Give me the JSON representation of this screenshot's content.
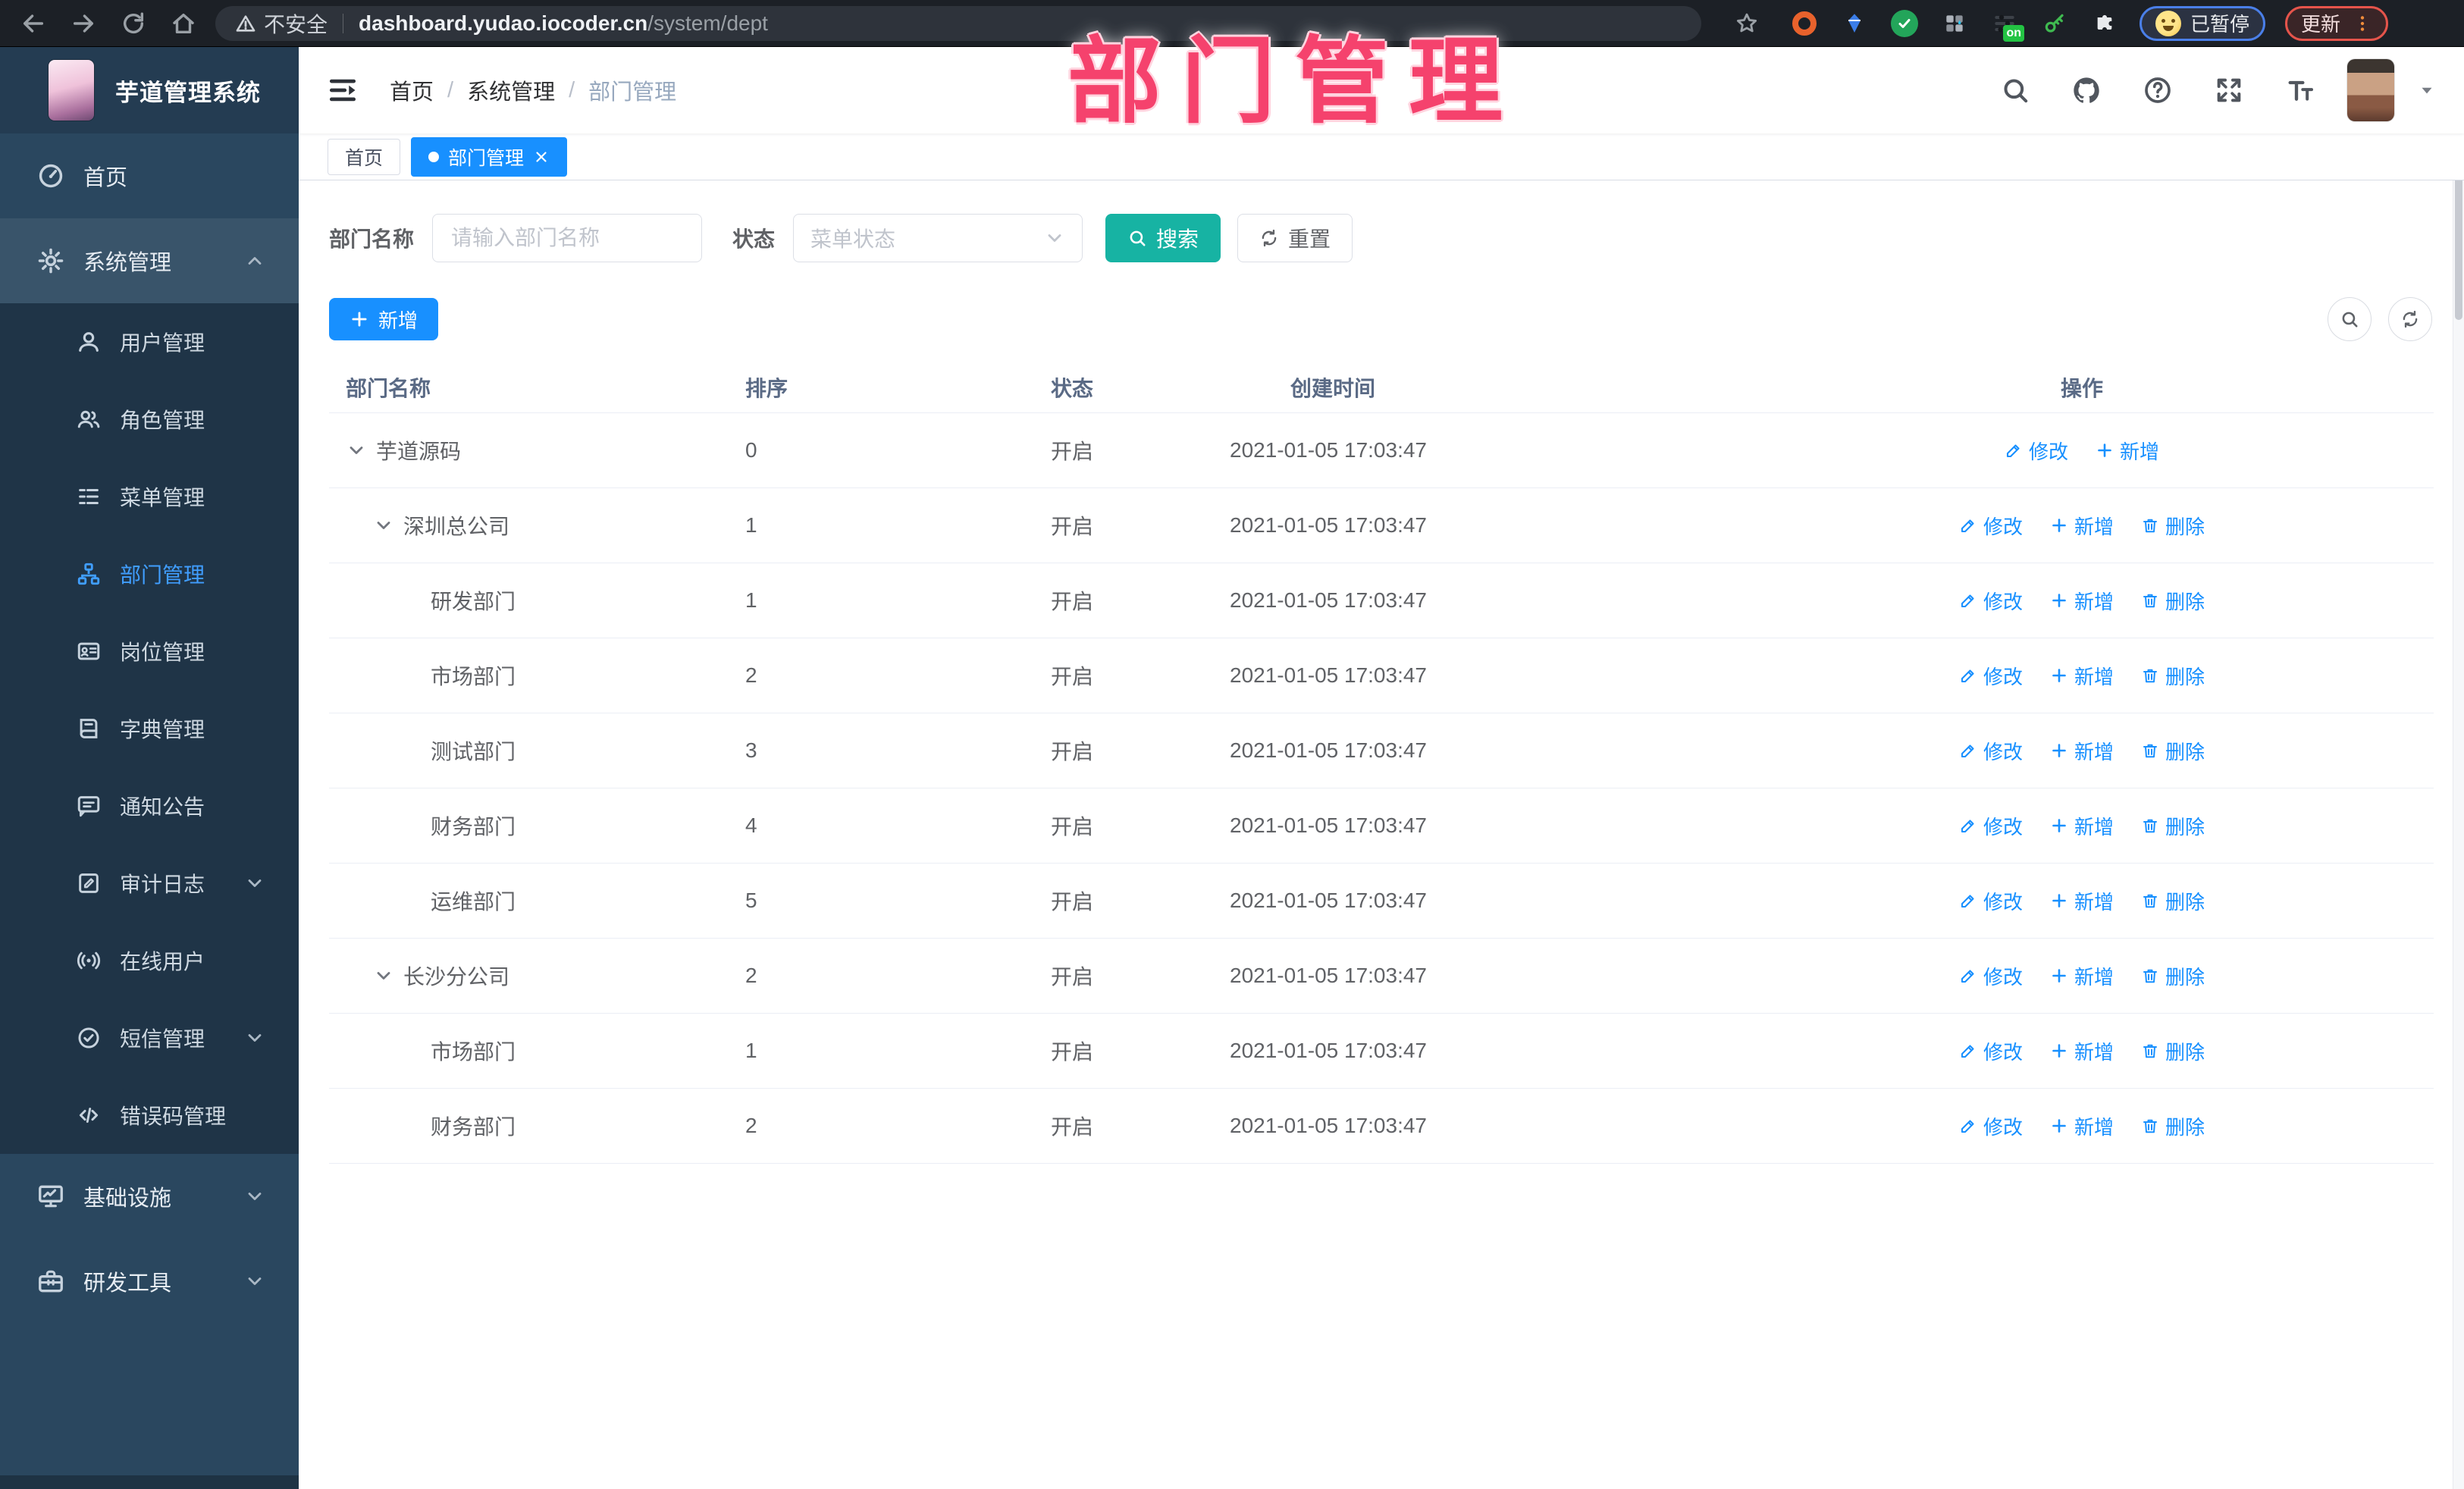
{
  "browser": {
    "security_label": "不安全",
    "url_domain": "dashboard.yudao.iocoder.cn",
    "url_path": "/system/dept",
    "profile_status": "已暂停",
    "update_label": "更新"
  },
  "sidebar": {
    "app_title": "芋道管理系统",
    "items": [
      {
        "key": "home",
        "label": "首页",
        "icon": "dashboard-icon",
        "level": "top"
      },
      {
        "key": "system-management",
        "label": "系统管理",
        "icon": "gear-icon",
        "level": "top",
        "chevron": "up",
        "highlighted": true
      },
      {
        "key": "user-management",
        "label": "用户管理",
        "icon": "user-icon",
        "level": "sub"
      },
      {
        "key": "role-management",
        "label": "角色管理",
        "icon": "roles-icon",
        "level": "sub"
      },
      {
        "key": "menu-management",
        "label": "菜单管理",
        "icon": "menu-list-icon",
        "level": "sub"
      },
      {
        "key": "dept-management",
        "label": "部门管理",
        "icon": "org-tree-icon",
        "level": "sub",
        "active": true
      },
      {
        "key": "post-management",
        "label": "岗位管理",
        "icon": "id-card-icon",
        "level": "sub"
      },
      {
        "key": "dict-management",
        "label": "字典管理",
        "icon": "dictionary-icon",
        "level": "sub"
      },
      {
        "key": "notice",
        "label": "通知公告",
        "icon": "announcement-icon",
        "level": "sub"
      },
      {
        "key": "audit-log",
        "label": "审计日志",
        "icon": "audit-log-icon",
        "level": "sub",
        "chevron": "down"
      },
      {
        "key": "online-user",
        "label": "在线用户",
        "icon": "online-user-icon",
        "level": "sub"
      },
      {
        "key": "sms-management",
        "label": "短信管理",
        "icon": "sms-check-icon",
        "level": "sub",
        "chevron": "down"
      },
      {
        "key": "error-code-management",
        "label": "错误码管理",
        "icon": "code-icon",
        "level": "sub"
      },
      {
        "key": "infrastructure",
        "label": "基础设施",
        "icon": "monitor-icon",
        "level": "top",
        "chevron": "down"
      },
      {
        "key": "dev-tools",
        "label": "研发工具",
        "icon": "toolbox-icon",
        "level": "top",
        "chevron": "down"
      }
    ]
  },
  "header": {
    "breadcrumb": [
      "首页",
      "系统管理",
      "部门管理"
    ]
  },
  "tabs": [
    {
      "key": "home",
      "label": "首页",
      "active": false
    },
    {
      "key": "dept-management",
      "label": "部门管理",
      "active": true
    }
  ],
  "annotation": {
    "text": "部门管理"
  },
  "search": {
    "name_label": "部门名称",
    "name_placeholder": "请输入部门名称",
    "status_label": "状态",
    "status_placeholder": "菜单状态",
    "search_label": "搜索",
    "reset_label": "重置"
  },
  "toolbar": {
    "add_label": "新增"
  },
  "table": {
    "headers": [
      "部门名称",
      "排序",
      "状态",
      "创建时间",
      "操作"
    ],
    "action_labels": {
      "edit": "修改",
      "add": "新增",
      "delete": "删除"
    },
    "rows": [
      {
        "name": "芋道源码",
        "level": 0,
        "expandable": true,
        "sort": "0",
        "status": "开启",
        "created": "2021-01-05 17:03:47",
        "actions": [
          "edit",
          "add"
        ]
      },
      {
        "name": "深圳总公司",
        "level": 1,
        "expandable": true,
        "sort": "1",
        "status": "开启",
        "created": "2021-01-05 17:03:47",
        "actions": [
          "edit",
          "add",
          "delete"
        ]
      },
      {
        "name": "研发部门",
        "level": 2,
        "expandable": false,
        "sort": "1",
        "status": "开启",
        "created": "2021-01-05 17:03:47",
        "actions": [
          "edit",
          "add",
          "delete"
        ]
      },
      {
        "name": "市场部门",
        "level": 2,
        "expandable": false,
        "sort": "2",
        "status": "开启",
        "created": "2021-01-05 17:03:47",
        "actions": [
          "edit",
          "add",
          "delete"
        ]
      },
      {
        "name": "测试部门",
        "level": 2,
        "expandable": false,
        "sort": "3",
        "status": "开启",
        "created": "2021-01-05 17:03:47",
        "actions": [
          "edit",
          "add",
          "delete"
        ]
      },
      {
        "name": "财务部门",
        "level": 2,
        "expandable": false,
        "sort": "4",
        "status": "开启",
        "created": "2021-01-05 17:03:47",
        "actions": [
          "edit",
          "add",
          "delete"
        ]
      },
      {
        "name": "运维部门",
        "level": 2,
        "expandable": false,
        "sort": "5",
        "status": "开启",
        "created": "2021-01-05 17:03:47",
        "actions": [
          "edit",
          "add",
          "delete"
        ]
      },
      {
        "name": "长沙分公司",
        "level": 1,
        "expandable": true,
        "sort": "2",
        "status": "开启",
        "created": "2021-01-05 17:03:47",
        "actions": [
          "edit",
          "add",
          "delete"
        ]
      },
      {
        "name": "市场部门",
        "level": 2,
        "expandable": false,
        "sort": "1",
        "status": "开启",
        "created": "2021-01-05 17:03:47",
        "actions": [
          "edit",
          "add",
          "delete"
        ]
      },
      {
        "name": "财务部门",
        "level": 2,
        "expandable": false,
        "sort": "2",
        "status": "开启",
        "created": "2021-01-05 17:03:47",
        "actions": [
          "edit",
          "add",
          "delete"
        ]
      }
    ]
  },
  "colors": {
    "accent": "#1890ff",
    "search_button": "#17b3a3",
    "sidebar_active": "#409eff",
    "annotation": "#f5426d"
  }
}
